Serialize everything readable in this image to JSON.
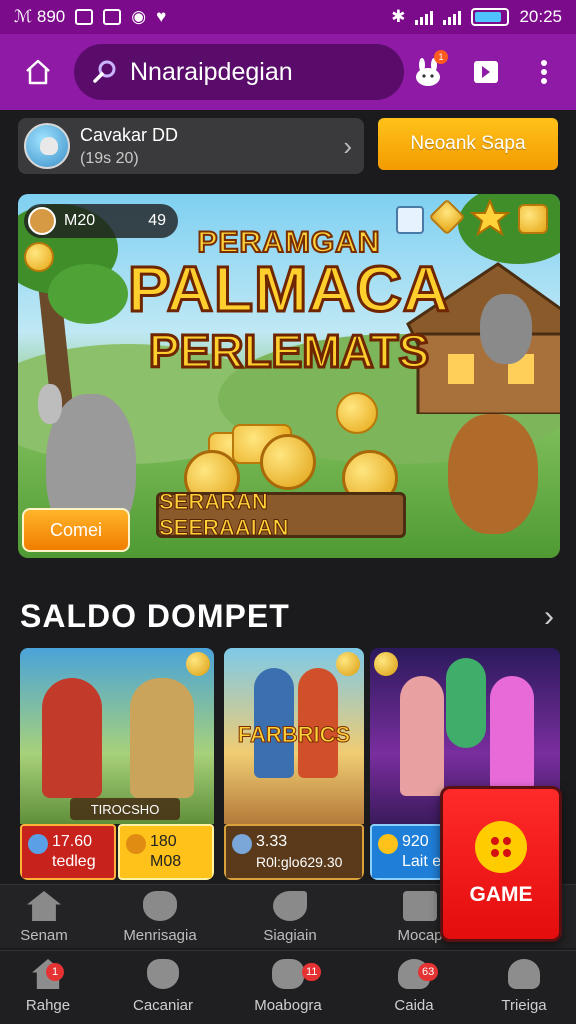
{
  "status_bar": {
    "left_text": "ℳ 890",
    "time": "20:25",
    "icons": [
      "notification-icon",
      "trend-icon",
      "check-icon",
      "record-icon",
      "heart-icon",
      "bluetooth-icon",
      "signal-icon",
      "signal-icon",
      "battery-icon"
    ]
  },
  "header": {
    "search_value": "Nnaraipdegian",
    "icons": [
      "home-icon",
      "search-icon",
      "bunny-icon",
      "share-icon",
      "more-icon"
    ],
    "notif_count": "1"
  },
  "profile": {
    "name": "Cavakar DD",
    "subtitle": "(19s 20)",
    "action_label": "Neoank Sapa"
  },
  "banner": {
    "chip_label": "M20",
    "chip_value": "49",
    "line1": "PERAMGAN",
    "line2": "PALMACA",
    "line3": "PERLEMATS",
    "sign": "SERARAN SEERAAIAN",
    "button_label": "Comei"
  },
  "section": {
    "title": "SALDO DOMPET"
  },
  "cards": [
    {
      "caption": "TIROCSHO",
      "stat1_value": "17.60",
      "stat1_sub": "tedleg",
      "stat2_value": "180",
      "stat2_sub": "M08"
    },
    {
      "title": "FARBRICS",
      "stat_value": "3.33",
      "stat_sub": "R0l:glo629.30"
    },
    {
      "stat_value": "920",
      "stat_sub": "Lait e"
    }
  ],
  "game_button": {
    "label": "GAME"
  },
  "secondary_row": [
    {
      "label": "Senam",
      "icon": "home-icon"
    },
    {
      "label": "Menrisagia",
      "icon": "cow-icon"
    },
    {
      "label": "Siagiain",
      "icon": "whistle-icon"
    },
    {
      "label": "Mocap",
      "icon": "dice-icon"
    }
  ],
  "bottom_nav": [
    {
      "label": "Rahge",
      "icon": "home-icon",
      "badge": "1"
    },
    {
      "label": "Cacaniar",
      "icon": "cow-icon",
      "badge": ""
    },
    {
      "label": "Moabogra",
      "icon": "controller-icon",
      "badge": "11"
    },
    {
      "label": "Caida",
      "icon": "profile-icon",
      "badge": "63"
    },
    {
      "label": "Trieiga",
      "icon": "user-icon",
      "badge": ""
    }
  ],
  "colors": {
    "status_bar": "#7c0b8c",
    "header": "#8e1aa6",
    "accent_orange": "#ffc21a",
    "game_red": "#ff2a2a",
    "background": "#1b1b1d"
  }
}
